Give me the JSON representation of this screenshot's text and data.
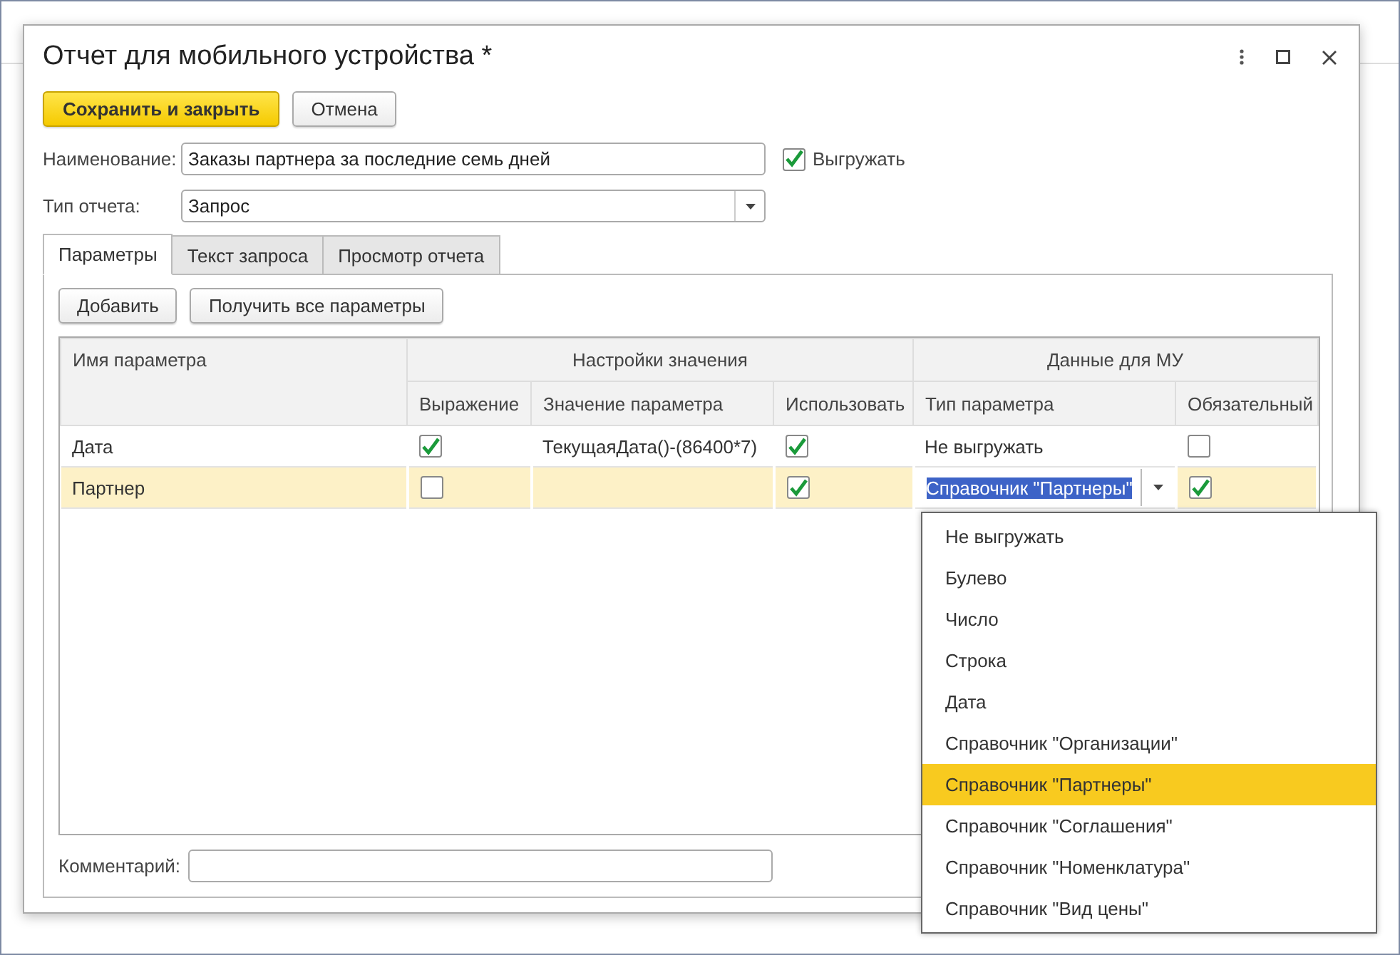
{
  "window": {
    "title": "Отчет для мобильного устройства *"
  },
  "toolbar": [
    {
      "label": "Сохранить и закрыть",
      "kind": "primary"
    },
    {
      "label": "Отмена",
      "kind": "normal"
    }
  ],
  "name_field": {
    "label": "Наименование:",
    "value": "Заказы партнера за последние семь дней"
  },
  "export_checkbox": {
    "label": "Выгружать",
    "checked": true
  },
  "report_type": {
    "label": "Тип отчета:",
    "value": "Запрос"
  },
  "tabs": [
    {
      "label": "Параметры",
      "selected": true
    },
    {
      "label": "Текст запроса",
      "selected": false
    },
    {
      "label": "Просмотр отчета",
      "selected": false
    }
  ],
  "table_buttons": [
    "Добавить",
    "Получить все параметры"
  ],
  "table": {
    "group_headers": [
      "Настройки значения",
      "Данные для МУ"
    ],
    "columns": [
      "Имя параметра",
      "Выражение",
      "Значение параметра",
      "Использовать",
      "Тип параметра",
      "Обязательный"
    ],
    "rows": [
      {
        "name": "Дата",
        "expression": true,
        "value": "ТекущаяДата()-(86400*7)",
        "use": true,
        "param_type": "Не выгружать",
        "required": false,
        "selected": false
      },
      {
        "name": "Партнер",
        "expression": false,
        "use": true,
        "param_type": "Справочник \"Партнеры\"",
        "required": true,
        "selected": true
      }
    ]
  },
  "dropdown": [
    {
      "label": "Не выгружать",
      "selected": false
    },
    {
      "label": "Булево",
      "selected": false
    },
    {
      "label": "Число",
      "selected": false
    },
    {
      "label": "Строка",
      "selected": false
    },
    {
      "label": "Дата",
      "selected": false
    },
    {
      "label": "Справочник \"Организации\"",
      "selected": false
    },
    {
      "label": "Справочник \"Партнеры\"",
      "selected": true
    },
    {
      "label": "Справочник \"Соглашения\"",
      "selected": false
    },
    {
      "label": "Справочник \"Номенклатура\"",
      "selected": false
    },
    {
      "label": "Справочник \"Вид цены\"",
      "selected": false
    }
  ],
  "comment": {
    "label": "Комментарий:"
  }
}
